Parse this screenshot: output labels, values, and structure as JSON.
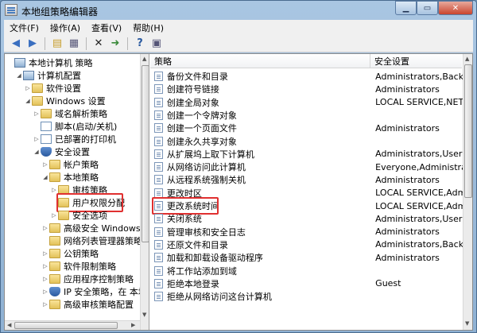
{
  "window": {
    "title": "本地组策略编辑器"
  },
  "menu": [
    {
      "label": "文件(F)"
    },
    {
      "label": "操作(A)"
    },
    {
      "label": "查看(V)"
    },
    {
      "label": "帮助(H)"
    }
  ],
  "toolbar": {
    "icons": [
      "back-arrow-icon",
      "forward-arrow-icon",
      "up-folder-icon",
      "show-hide-tree-icon",
      "delete-icon",
      "export-icon",
      "help-icon",
      "properties-icon"
    ]
  },
  "tree": [
    {
      "label": "本地计算机 策略",
      "expand": "",
      "icon": "pc",
      "indent": 0
    },
    {
      "label": "计算机配置",
      "expand": "◢",
      "icon": "pc",
      "indent": 1
    },
    {
      "label": "软件设置",
      "expand": "▷",
      "icon": "folder",
      "indent": 2
    },
    {
      "label": "Windows 设置",
      "expand": "◢",
      "icon": "folder",
      "indent": 2
    },
    {
      "label": "域名解析策略",
      "expand": "▷",
      "icon": "folder",
      "indent": 3
    },
    {
      "label": "脚本(启动/关机)",
      "expand": "",
      "icon": "doc",
      "indent": 3
    },
    {
      "label": "已部署的打印机",
      "expand": "▷",
      "icon": "doc",
      "indent": 3
    },
    {
      "label": "安全设置",
      "expand": "◢",
      "icon": "shield",
      "indent": 3
    },
    {
      "label": "帐户策略",
      "expand": "▷",
      "icon": "folder",
      "indent": 4
    },
    {
      "label": "本地策略",
      "expand": "◢",
      "icon": "folder",
      "indent": 4
    },
    {
      "label": "审核策略",
      "expand": "▷",
      "icon": "folder",
      "indent": 5
    },
    {
      "label": "用户权限分配",
      "expand": "",
      "icon": "folder",
      "indent": 5,
      "selected": true
    },
    {
      "label": "安全选项",
      "expand": "▷",
      "icon": "folder",
      "indent": 5
    },
    {
      "label": "高级安全 Windows",
      "expand": "▷",
      "icon": "folder",
      "indent": 4
    },
    {
      "label": "网络列表管理器策略",
      "expand": "",
      "icon": "folder",
      "indent": 4
    },
    {
      "label": "公钥策略",
      "expand": "▷",
      "icon": "folder",
      "indent": 4
    },
    {
      "label": "软件限制策略",
      "expand": "▷",
      "icon": "folder",
      "indent": 4
    },
    {
      "label": "应用程序控制策略",
      "expand": "▷",
      "icon": "folder",
      "indent": 4
    },
    {
      "label": "IP 安全策略，在 本地",
      "expand": "▷",
      "icon": "shield",
      "indent": 4
    },
    {
      "label": "高级审核策略配置",
      "expand": "▷",
      "icon": "folder",
      "indent": 4
    }
  ],
  "columns": {
    "policy": "策略",
    "setting": "安全设置"
  },
  "policies": [
    {
      "name": "备份文件和目录",
      "value": "Administrators,Backu..."
    },
    {
      "name": "创建符号链接",
      "value": "Administrators"
    },
    {
      "name": "创建全局对象",
      "value": "LOCAL SERVICE,NET..."
    },
    {
      "name": "创建一个令牌对象",
      "value": ""
    },
    {
      "name": "创建一个页面文件",
      "value": "Administrators"
    },
    {
      "name": "创建永久共享对象",
      "value": ""
    },
    {
      "name": "从扩展坞上取下计算机",
      "value": "Administrators,Users"
    },
    {
      "name": "从网络访问此计算机",
      "value": "Everyone,Administrat..."
    },
    {
      "name": "从远程系统强制关机",
      "value": "Administrators"
    },
    {
      "name": "更改时区",
      "value": "LOCAL SERVICE,Admi..."
    },
    {
      "name": "更改系统时间",
      "value": "LOCAL SERVICE,Admi..."
    },
    {
      "name": "关闭系统",
      "value": "Administrators,Users,..."
    },
    {
      "name": "管理审核和安全日志",
      "value": "Administrators"
    },
    {
      "name": "还原文件和目录",
      "value": "Administrators,Backu..."
    },
    {
      "name": "加载和卸载设备驱动程序",
      "value": "Administrators"
    },
    {
      "name": "将工作站添加到域",
      "value": ""
    },
    {
      "name": "拒绝本地登录",
      "value": "Guest"
    },
    {
      "name": "拒绝从网络访问这台计算机",
      "value": ""
    }
  ]
}
